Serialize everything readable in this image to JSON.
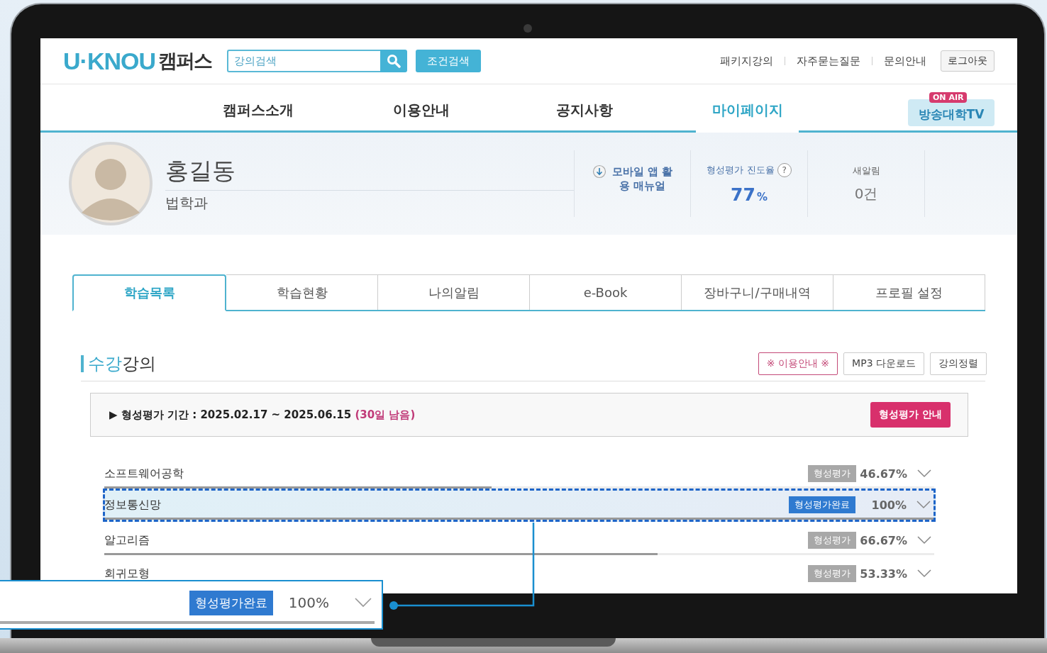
{
  "header": {
    "logo_mark": "U·KNOU",
    "logo_text": "캠퍼스",
    "search": {
      "placeholder": "강의검색"
    },
    "filter_button": "조건검색",
    "top_links": [
      "패키지강의",
      "자주묻는질문",
      "문의안내"
    ],
    "logout_button": "로그아웃"
  },
  "nav": [
    {
      "label": "캠퍼스소개",
      "selected": false
    },
    {
      "label": "이용안내",
      "selected": false
    },
    {
      "label": "공지사항",
      "selected": false
    },
    {
      "label": "마이페이지",
      "selected": true
    }
  ],
  "tv_button": {
    "badge": "ON AIR",
    "label": "방송대학TV"
  },
  "profile": {
    "name": "홍길동",
    "department": "법학과",
    "manual": "모바일 앱 활용 매뉴얼",
    "progress": {
      "label": "형성평가 진도율",
      "help": "?",
      "value": "77",
      "unit": "%"
    },
    "alerts": {
      "label": "새알림",
      "value": "0건"
    }
  },
  "tabs": [
    {
      "label": "학습목록",
      "selected": true
    },
    {
      "label": "학습현황",
      "selected": false
    },
    {
      "label": "나의알림",
      "selected": false
    },
    {
      "label": "e-Book",
      "selected": false
    },
    {
      "label": "장바구니/구매내역",
      "selected": false
    },
    {
      "label": "프로필 설정",
      "selected": false
    }
  ],
  "section": {
    "title_accent": "수강",
    "title_rest": "강의",
    "buttons": [
      {
        "label": "※ 이용안내 ※",
        "kind": "accent"
      },
      {
        "label": "MP3 다운로드",
        "kind": "plain"
      },
      {
        "label": "강의정렬",
        "kind": "plain"
      }
    ]
  },
  "notice": {
    "text": "▶ 형성평가 기간 : 2025.02.17 ~ 2025.06.15",
    "remaining": "(30일 남음)",
    "button": "형성평가 안내"
  },
  "courses": [
    {
      "name": "소프트웨어공학",
      "badge": "형성평가",
      "completed": false,
      "percent": "46.67%",
      "level": 0.4667,
      "highlighted": false
    },
    {
      "name": "정보통신망",
      "badge": "형성평가완료",
      "completed": true,
      "percent": "100%",
      "level": 1,
      "highlighted": true
    },
    {
      "name": "알고리즘",
      "badge": "형성평가",
      "completed": false,
      "percent": "66.67%",
      "level": 0.6667,
      "highlighted": false
    },
    {
      "name": "회귀모형",
      "badge": "형성평가",
      "completed": false,
      "percent": "53.33%",
      "highlighted": false
    }
  ],
  "callout": {
    "badge": "형성평가완료",
    "percent": "100%",
    "level": 1
  }
}
